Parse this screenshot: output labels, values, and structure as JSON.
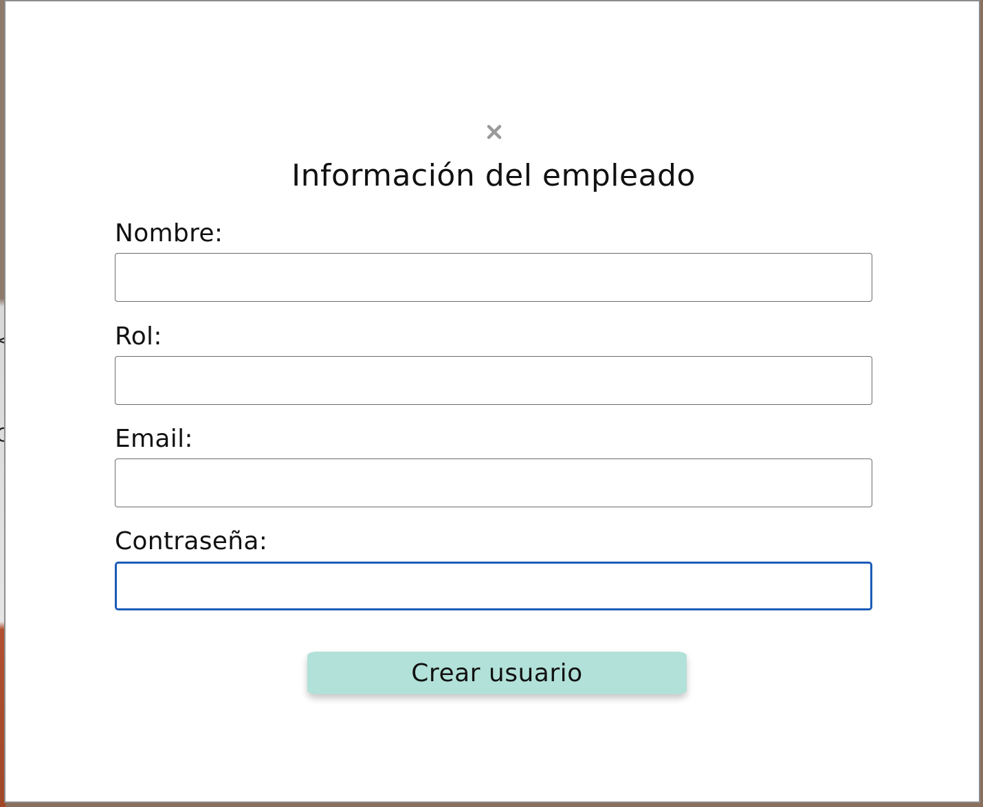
{
  "modal": {
    "title": "Información del empleado",
    "close_icon": "close-x-icon",
    "fields": [
      {
        "label": "Nombre:",
        "value": "",
        "placeholder": ""
      },
      {
        "label": "Rol:",
        "value": "",
        "placeholder": ""
      },
      {
        "label": "Email:",
        "value": "",
        "placeholder": ""
      },
      {
        "label": "Contraseña:",
        "value": "",
        "placeholder": "",
        "focused": true
      }
    ],
    "submit_label": "Crear usuario",
    "colors": {
      "submit_bg": "#b1e1d8",
      "focus_border": "#1a5bb8",
      "close_icon": "#9a9a9a"
    }
  }
}
